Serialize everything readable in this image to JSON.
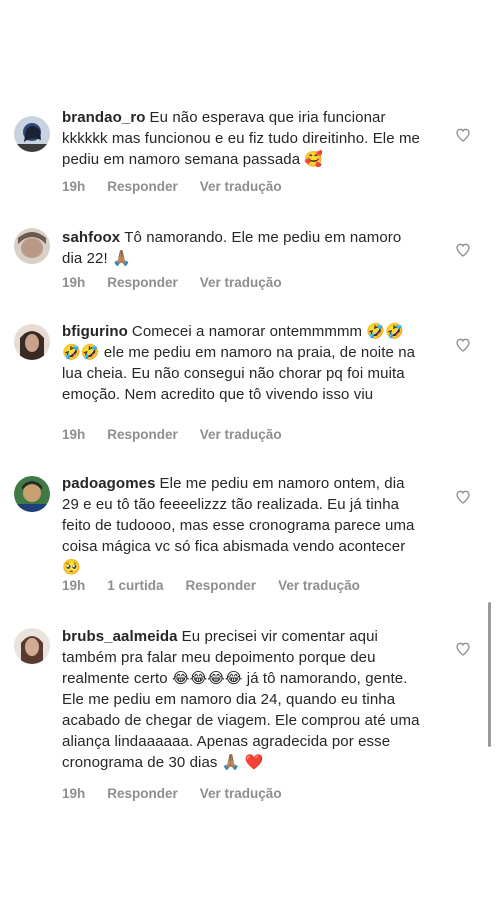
{
  "comments": [
    {
      "username": "brandao_ro",
      "text": "Eu não esperava que iria funcionar kkkkkk mas funcionou e eu fiz tudo direitinho. Ele me pediu em namoro semana passada 🥰",
      "time": "19h",
      "likes": "",
      "reply": "Responder",
      "translate": "Ver tradução",
      "avatar_icon": "avatar-photo-icon",
      "avatar_color": "#2b4a7a"
    },
    {
      "username": "sahfoox",
      "text": "Tô namorando. Ele me pediu em namoro dia 22! 🙏🏽",
      "time": "19h",
      "likes": "",
      "reply": "Responder",
      "translate": "Ver tradução",
      "avatar_icon": "avatar-photo-icon",
      "avatar_color": "#6b5a4e"
    },
    {
      "username": "bfigurino",
      "text": "Comecei a namorar ontemmmmm 🤣🤣🤣🤣 ele me pediu em namoro na praia, de noite na lua cheia. Eu não consegui não chorar pq foi muita emoção. Nem acredito que tô vivendo isso viu",
      "time": "19h",
      "likes": "",
      "reply": "Responder",
      "translate": "Ver tradução",
      "avatar_icon": "avatar-photo-icon",
      "avatar_color": "#3a2a24"
    },
    {
      "username": "padoagomes",
      "text": "Ele me pediu em namoro ontem, dia 29 e eu tô tão feeeelizzz tão realizada. Eu já tinha feito de tudoooo, mas esse cronograma parece uma coisa mágica vc só fica abismada vendo acontecer 🥺",
      "time": "19h",
      "likes": "1 curtida",
      "reply": "Responder",
      "translate": "Ver tradução",
      "avatar_icon": "avatar-photo-icon",
      "avatar_color": "#2f6b3a"
    },
    {
      "username": "brubs_aalmeida",
      "text": "Eu precisei vir comentar aqui também pra falar meu depoimento porque deu realmente certo 😂😂😂😂 já tô namorando, gente. Ele me pediu em namoro dia 24, quando eu tinha acabado de chegar de viagem. Ele comprou até uma aliança lindaaaaaa. Apenas agradecida por esse cronograma de 30 dias 🙏🏽 ❤️",
      "time": "19h",
      "likes": "",
      "reply": "Responder",
      "translate": "Ver tradução",
      "avatar_icon": "avatar-photo-icon",
      "avatar_color": "#5a3a30"
    }
  ],
  "like_icon": "heart-outline-icon"
}
